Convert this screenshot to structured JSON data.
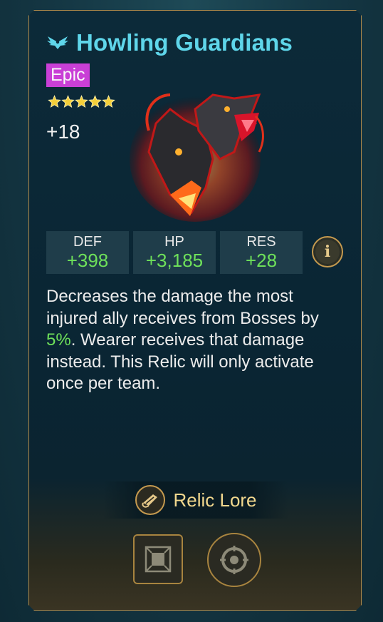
{
  "relic": {
    "name": "Howling Guardians",
    "rarity": "Epic",
    "rarity_color": "#c93fd6",
    "title_color": "#5fd6ea",
    "stars": 5,
    "level": "+18",
    "icon": "eagle-wings-icon",
    "art": "wolf-heads-relic-art"
  },
  "stats": [
    {
      "name": "DEF",
      "value": "+398"
    },
    {
      "name": "HP",
      "value": "+3,185"
    },
    {
      "name": "RES",
      "value": "+28"
    }
  ],
  "description": {
    "part1": "Decreases the damage the most injured ally receives from Bosses by ",
    "highlight": "5%",
    "part2": ". Wearer receives that damage instead. This Relic will only activate once per team.",
    "highlight_color": "#6ee05a"
  },
  "lore": {
    "label": "Relic Lore",
    "icon": "scroll-icon"
  },
  "actions": {
    "left_icon": "frame-icon",
    "right_icon": "target-icon"
  },
  "info_icon": "info-icon"
}
